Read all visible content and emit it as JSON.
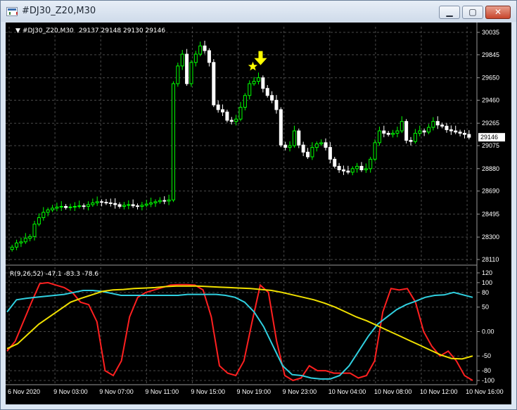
{
  "window": {
    "title": "#DJ30_Z20,M30",
    "minimize_glyph": "▁",
    "maximize_glyph": "▢",
    "close_glyph": "✕"
  },
  "chart_data": [
    {
      "type": "candlestick",
      "title": "#DJ30_Z20,M30",
      "ohlc_label": "29137 29148 29130 29146",
      "current_price_label": "29146",
      "y_ticks": [
        "30035",
        "29845",
        "29650",
        "29460",
        "29265",
        "29075",
        "28880",
        "28690",
        "28495",
        "28300",
        "28110"
      ],
      "x_ticks": [
        "6 Nov 2020",
        "9 Nov 03:00",
        "9 Nov 07:00",
        "9 Nov 11:00",
        "9 Nov 15:00",
        "9 Nov 19:00",
        "9 Nov 23:00",
        "10 Nov 04:00",
        "10 Nov 08:00",
        "10 Nov 12:00",
        "10 Nov 16:00"
      ],
      "ylim": [
        28110,
        30035
      ],
      "colors": {
        "bull": "#00ff00",
        "bear": "#ffffff",
        "grid": "#4a4a4a",
        "marker": "#ffff00"
      },
      "closes": [
        28215,
        28250,
        28260,
        28290,
        28305,
        28410,
        28465,
        28510,
        28530,
        28545,
        28555,
        28560,
        28550,
        28555,
        28560,
        28565,
        28560,
        28575,
        28590,
        28600,
        28595,
        28590,
        28585,
        28575,
        28560,
        28570,
        28575,
        28565,
        28560,
        28570,
        28580,
        28590,
        28600,
        28610,
        28605,
        28615,
        29600,
        29750,
        29850,
        29600,
        29780,
        29850,
        29920,
        29880,
        29780,
        29420,
        29380,
        29360,
        29290,
        29280,
        29300,
        29400,
        29500,
        29600,
        29620,
        29650,
        29560,
        29500,
        29460,
        29380,
        29080,
        29060,
        29075,
        29200,
        29080,
        29020,
        28980,
        29060,
        29090,
        29100,
        29060,
        28960,
        28900,
        28870,
        28860,
        28850,
        28880,
        28900,
        28870,
        28880,
        28960,
        29100,
        29200,
        29180,
        29170,
        29180,
        29200,
        29280,
        29120,
        29110,
        29180,
        29200,
        29190,
        29230,
        29280,
        29250,
        29240,
        29210,
        29200,
        29190,
        29180,
        29170,
        29146
      ]
    },
    {
      "type": "line",
      "title": "R(9,26,52) -47.1 -83.3 -78.6",
      "y_ticks": [
        "120",
        "100",
        "80",
        "50",
        "0.00",
        "-50",
        "-80",
        "-100"
      ],
      "ylim": [
        -100,
        120
      ],
      "series": [
        {
          "color": "#ff2020",
          "values": [
            -40,
            -20,
            20,
            60,
            98,
            100,
            95,
            90,
            80,
            60,
            55,
            20,
            -80,
            -90,
            -60,
            30,
            70,
            80,
            85,
            90,
            95,
            96,
            96,
            95,
            85,
            30,
            -70,
            -85,
            -90,
            -60,
            20,
            95,
            80,
            -20,
            -90,
            -100,
            -95,
            -70,
            -80,
            -80,
            -85,
            -85,
            -85,
            -95,
            -90,
            -60,
            40,
            88,
            85,
            88,
            60,
            0,
            -30,
            -50,
            -40,
            -60,
            -90,
            -100
          ]
        },
        {
          "color": "#30d0e0",
          "values": [
            40,
            65,
            68,
            70,
            72,
            74,
            76,
            80,
            84,
            84,
            82,
            78,
            74,
            74,
            74,
            74,
            74,
            74,
            74,
            76,
            76,
            76,
            76,
            74,
            70,
            60,
            40,
            10,
            -30,
            -70,
            -88,
            -90,
            -95,
            -97,
            -97,
            -90,
            -70,
            -40,
            -10,
            15,
            30,
            45,
            55,
            62,
            70,
            74,
            75,
            80,
            75,
            70
          ]
        },
        {
          "color": "#f0e000",
          "values": [
            -35,
            -25,
            -5,
            15,
            30,
            45,
            60,
            68,
            75,
            82,
            85,
            86,
            88,
            89,
            90,
            92,
            93,
            93,
            93,
            92,
            91,
            90,
            89,
            88,
            86,
            84,
            80,
            75,
            70,
            65,
            58,
            50,
            40,
            30,
            22,
            12,
            2,
            -8,
            -18,
            -28,
            -38,
            -48,
            -55,
            -56,
            -50
          ]
        }
      ]
    }
  ]
}
